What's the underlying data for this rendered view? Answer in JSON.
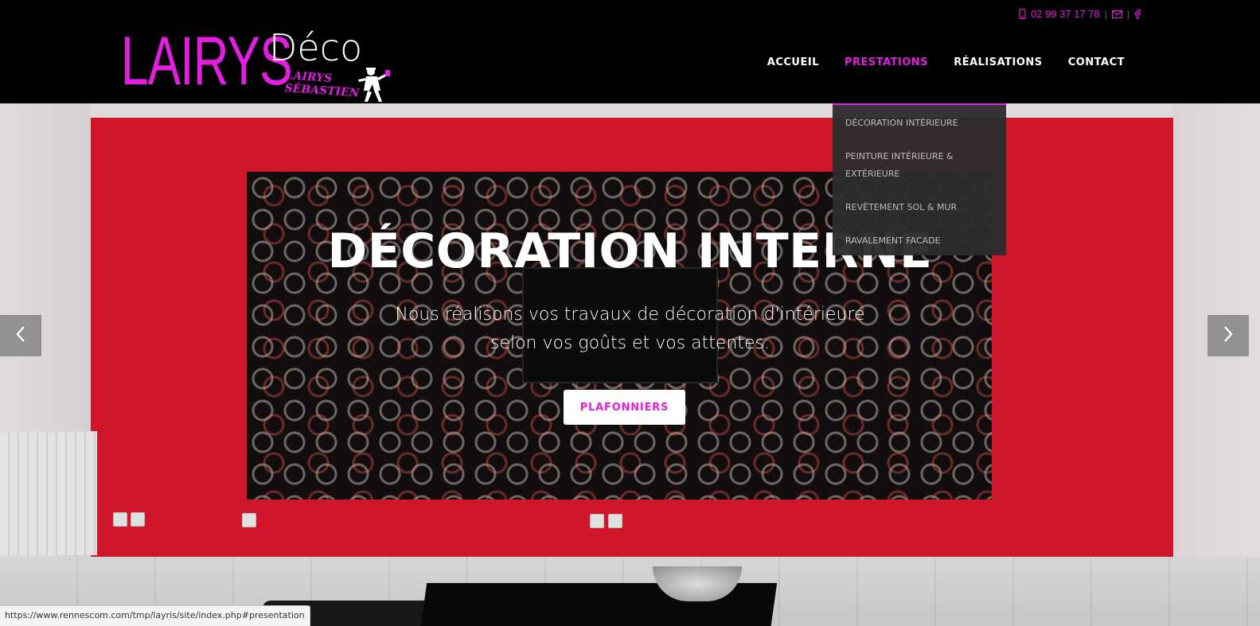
{
  "topbar": {
    "phone": "02 99 37 17 78",
    "icons": [
      "phone-icon",
      "mail-icon",
      "facebook-icon"
    ]
  },
  "logo": {
    "brand": "LAIRYS",
    "deco": "Déco",
    "signature": "LAIRYS SÉBASTIEN"
  },
  "nav": {
    "items": [
      {
        "label": "ACCUEIL"
      },
      {
        "label": "PRESTATIONS"
      },
      {
        "label": "RÉALISATIONS"
      },
      {
        "label": "CONTACT"
      }
    ],
    "active": "PRESTATIONS"
  },
  "dropdown": {
    "items": [
      {
        "label": "DÉCORATION INTÉRIEURE"
      },
      {
        "label": "PEINTURE INTÉRIEURE & EXTÉRIEURE"
      },
      {
        "label": "REVÊTEMENT SOL & MUR"
      },
      {
        "label": "RAVALEMENT FACADE"
      }
    ]
  },
  "hero": {
    "title": "DÉCORATION INTERNE",
    "subtitle_line1": "Nous réalisons vos travaux de décoration d'intérieure",
    "subtitle_line2": "selon vos goûts et vos attentes.",
    "button_label": "PLAFONNIERS"
  },
  "status_url": "https://www.rennescom.com/tmp/layris/site/index.php#presentation",
  "colors": {
    "accent": "#e41ee0",
    "header_bg": "#000000",
    "dropdown_bg": "#2d2d2d",
    "wall_red": "#e2182e"
  }
}
